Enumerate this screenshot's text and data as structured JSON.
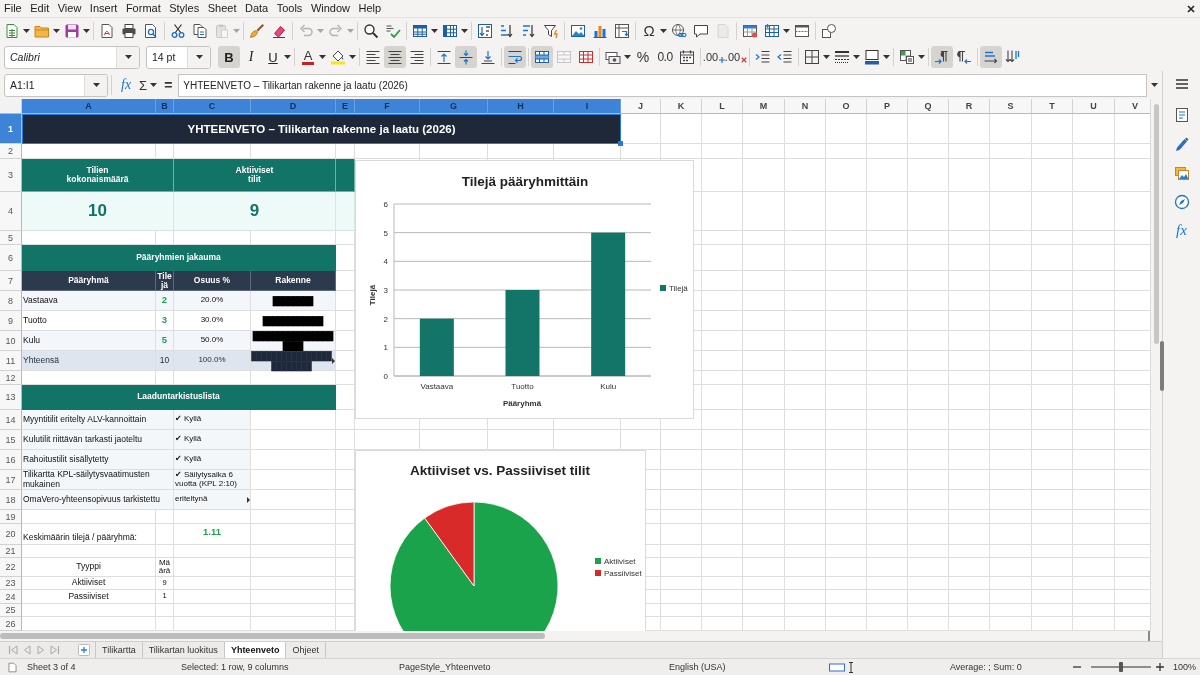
{
  "menu_bar": {
    "items": [
      "File",
      "Edit",
      "View",
      "Insert",
      "Format",
      "Styles",
      "Sheet",
      "Data",
      "Tools",
      "Window",
      "Help"
    ]
  },
  "standard_toolbar": {
    "paste": {
      "disabled": true
    },
    "undo": {
      "disabled": true
    },
    "redo": {
      "disabled": true
    },
    "special_character": {
      "label": "Ω"
    },
    "headers_footers": {
      "disabled": true
    }
  },
  "formatting_toolbar": {
    "font_name": "Calibri",
    "font_size": "14 pt",
    "bold": {
      "label": "B",
      "on": true
    },
    "italic": {
      "label": "I",
      "on": false
    },
    "underline": {
      "label": "U",
      "on": false
    },
    "font_color": {
      "label": "A"
    },
    "align_left": {
      "on": false
    },
    "align_center": {
      "on": true
    },
    "align_right": {
      "on": false
    },
    "align_top": {
      "on": false
    },
    "align_middle": {
      "on": true
    },
    "align_bottom": {
      "on": false
    },
    "wrap_text": {
      "on": true
    },
    "merge_and_center": {
      "on": true
    },
    "merge_cells": {
      "disabled": true
    },
    "percent": {
      "label": "%"
    },
    "general_format": {
      "label": "0.0"
    },
    "add_decimal": {
      "label": ".00"
    },
    "delete_decimal": {
      "label": ".00"
    },
    "left_to_right": {
      "on": true
    },
    "right_to_left": {
      "on": false
    },
    "text_left_to_right": {
      "on": true
    },
    "text_top_to_bottom": {
      "on": false
    }
  },
  "formula_bar": {
    "name_box": "A1:I1",
    "function_wizard": "fx",
    "sum": "Σ",
    "equals": "=",
    "content": "YHTEENVETO – Tilikartan rakenne ja laatu (2026)"
  },
  "sheet": {
    "columns": [
      {
        "label": "A",
        "selected": true
      },
      {
        "label": "B",
        "selected": true
      },
      {
        "label": "C",
        "selected": true
      },
      {
        "label": "D",
        "selected": true
      },
      {
        "label": "E",
        "selected": true
      },
      {
        "label": "F",
        "selected": true
      },
      {
        "label": "G",
        "selected": true
      },
      {
        "label": "H",
        "selected": true
      },
      {
        "label": "I",
        "selected": true
      },
      {
        "label": "J",
        "selected": false
      },
      {
        "label": "K",
        "selected": false
      },
      {
        "label": "L",
        "selected": false
      },
      {
        "label": "M",
        "selected": false
      },
      {
        "label": "N",
        "selected": false
      },
      {
        "label": "O",
        "selected": false
      },
      {
        "label": "P",
        "selected": false
      },
      {
        "label": "Q",
        "selected": false
      },
      {
        "label": "R",
        "selected": false
      },
      {
        "label": "S",
        "selected": false
      },
      {
        "label": "T",
        "selected": false
      },
      {
        "label": "U",
        "selected": false
      },
      {
        "label": "V",
        "selected": false
      }
    ],
    "rows": [
      {
        "label": "1",
        "selected": true
      },
      {
        "label": "2",
        "selected": false
      },
      {
        "label": "3",
        "selected": false
      },
      {
        "label": "4",
        "selected": false
      },
      {
        "label": "5",
        "selected": false
      },
      {
        "label": "6",
        "selected": false
      },
      {
        "label": "7",
        "selected": false
      },
      {
        "label": "8",
        "selected": false
      },
      {
        "label": "9",
        "selected": false
      },
      {
        "label": "10",
        "selected": false
      },
      {
        "label": "11",
        "selected": false
      },
      {
        "label": "12",
        "selected": false
      },
      {
        "label": "13",
        "selected": false
      },
      {
        "label": "14",
        "selected": false
      },
      {
        "label": "15",
        "selected": false
      },
      {
        "label": "16",
        "selected": false
      },
      {
        "label": "17",
        "selected": false
      },
      {
        "label": "18",
        "selected": false
      },
      {
        "label": "19",
        "selected": false
      },
      {
        "label": "20",
        "selected": false
      },
      {
        "label": "21",
        "selected": false
      },
      {
        "label": "22",
        "selected": false
      },
      {
        "label": "23",
        "selected": false
      },
      {
        "label": "24",
        "selected": false
      },
      {
        "label": "25",
        "selected": false
      },
      {
        "label": "26",
        "selected": false
      }
    ],
    "title": {
      "text": "YHTEENVETO – Tilikartan rakenne ja laatu (2026)",
      "selected": true
    },
    "kpis": [
      {
        "label": "Tilien kokonaismäärä",
        "value": "10"
      },
      {
        "label": "Aktiiviset tilit",
        "value": "9"
      }
    ],
    "groups": {
      "title": "Pääryhmien jakauma",
      "columns": [
        "Pääryhmä",
        "Tilejä",
        "Osuus %",
        "Rakenne"
      ],
      "rows": [
        {
          "kind": "item",
          "group": "Vastaava",
          "count": "2",
          "share": "20.0%",
          "bar": "████████",
          "overflow": false
        },
        {
          "kind": "item",
          "group": "Tuotto",
          "count": "3",
          "share": "30.0%",
          "bar": "████████████",
          "overflow": false
        },
        {
          "kind": "item",
          "group": "Kulu",
          "count": "5",
          "share": "50.0%",
          "bar": "████████████████████",
          "overflow": false
        },
        {
          "kind": "total",
          "group": "Yhteensä",
          "count": "10",
          "share": "100.0%",
          "bar": "████████████████████████",
          "overflow": true
        }
      ]
    },
    "checklist": {
      "title": "Laaduntarkistuslista",
      "items": [
        {
          "check": "Myyntitilit eritelty ALV-kannoittain",
          "result": "✔ Kyllä",
          "overflow": false
        },
        {
          "check": "Kulutilit riittävän tarkasti jaoteltu",
          "result": "✔ Kyllä",
          "overflow": false
        },
        {
          "check": "Rahoitustilit sisällytetty",
          "result": "✔ Kyllä",
          "overflow": false
        },
        {
          "check": "Tilikartta KPL-säilytysvaatimusten mukainen",
          "result": "✔ Säilytysaika 6 vuotta (KPL 2:10)",
          "overflow": false
        },
        {
          "check": "OmaVero-yhteensopivuus tarkistettu",
          "result": "eriteltynä",
          "overflow": true
        }
      ]
    },
    "average": {
      "label": "Keskimäärin tilejä / pääryhmä:",
      "value": "1.11"
    },
    "type_table": {
      "columns": [
        "Tyyppi",
        "Määrä"
      ],
      "rows": [
        {
          "type": "Aktiiviset",
          "count": "9"
        },
        {
          "type": "Passiiviset",
          "count": "1"
        }
      ]
    },
    "charts": [
      {
        "chart_data": {
          "type": "bar",
          "title": "Tilejä pääryhmittäin",
          "xlabel": "Pääryhmä",
          "ylabel": "Tilejä",
          "categories": [
            "Vastaava",
            "Tuotto",
            "Kulu"
          ],
          "series": [
            {
              "name": "Tilejä",
              "color": "#137468",
              "values": [
                2,
                3,
                5
              ]
            }
          ],
          "ylim": [
            0,
            6
          ],
          "yticks": [
            {
              "value": 0,
              "label": "0"
            },
            {
              "value": 1,
              "label": "1"
            },
            {
              "value": 2,
              "label": "2"
            },
            {
              "value": 3,
              "label": "3"
            },
            {
              "value": 4,
              "label": "4"
            },
            {
              "value": 5,
              "label": "5"
            },
            {
              "value": 6,
              "label": "6"
            }
          ],
          "grid": true,
          "legend": "right"
        }
      },
      {
        "chart_data": {
          "type": "pie",
          "title": "Aktiiviset vs. Passiiviset tilit",
          "categories": [
            "Aktiiviset",
            "Passiiviset"
          ],
          "values": [
            90,
            10
          ],
          "colors": [
            "#1aa34a",
            "#d92a2a"
          ],
          "legend": "right"
        }
      }
    ]
  },
  "sheet_tabs": [
    {
      "label": "Tilikartta",
      "selected": false
    },
    {
      "label": "Tilikartan luokitus",
      "selected": false
    },
    {
      "label": "Yhteenveto",
      "selected": true
    },
    {
      "label": "Ohjeet",
      "selected": false
    }
  ],
  "sidebar": {
    "functions": "fx"
  },
  "status_bar": {
    "sheet": "Sheet 3 of 4",
    "selection": "Selected: 1 row, 9 columns",
    "page_style": "PageStyle_Yhteenveto",
    "language": "English (USA)",
    "summary": "Average: ; Sum: 0",
    "zoom": {
      "level": 0.5,
      "label": "100%"
    }
  }
}
